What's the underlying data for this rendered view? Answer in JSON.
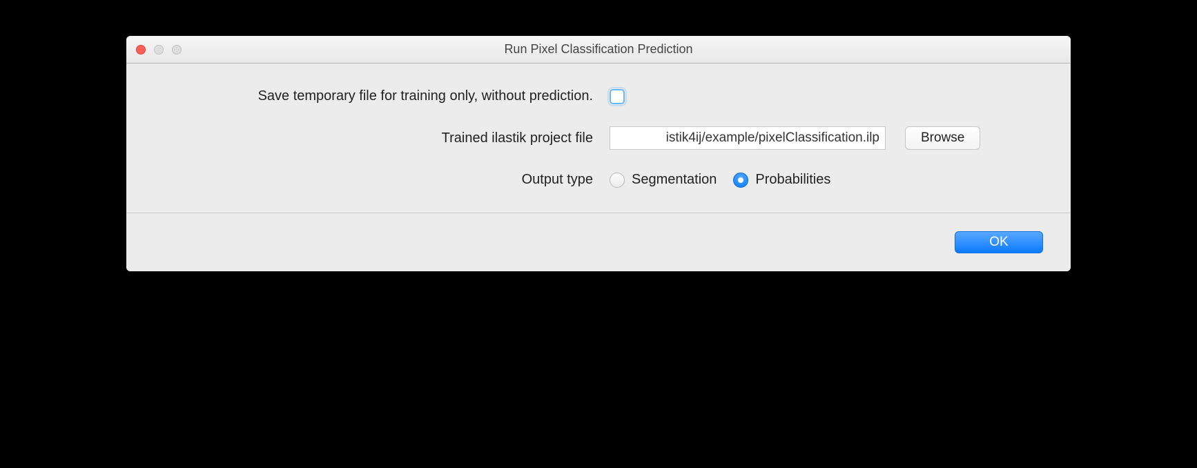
{
  "window": {
    "title": "Run Pixel Classification Prediction"
  },
  "form": {
    "save_temp": {
      "label": "Save temporary file for training only, without prediction.",
      "checked": false
    },
    "project_file": {
      "label": "Trained ilastik project file",
      "value": "istik4ij/example/pixelClassification.ilp",
      "browse_label": "Browse"
    },
    "output_type": {
      "label": "Output type",
      "options": {
        "segmentation": "Segmentation",
        "probabilities": "Probabilities"
      },
      "selected": "probabilities"
    }
  },
  "footer": {
    "ok_label": "OK"
  }
}
